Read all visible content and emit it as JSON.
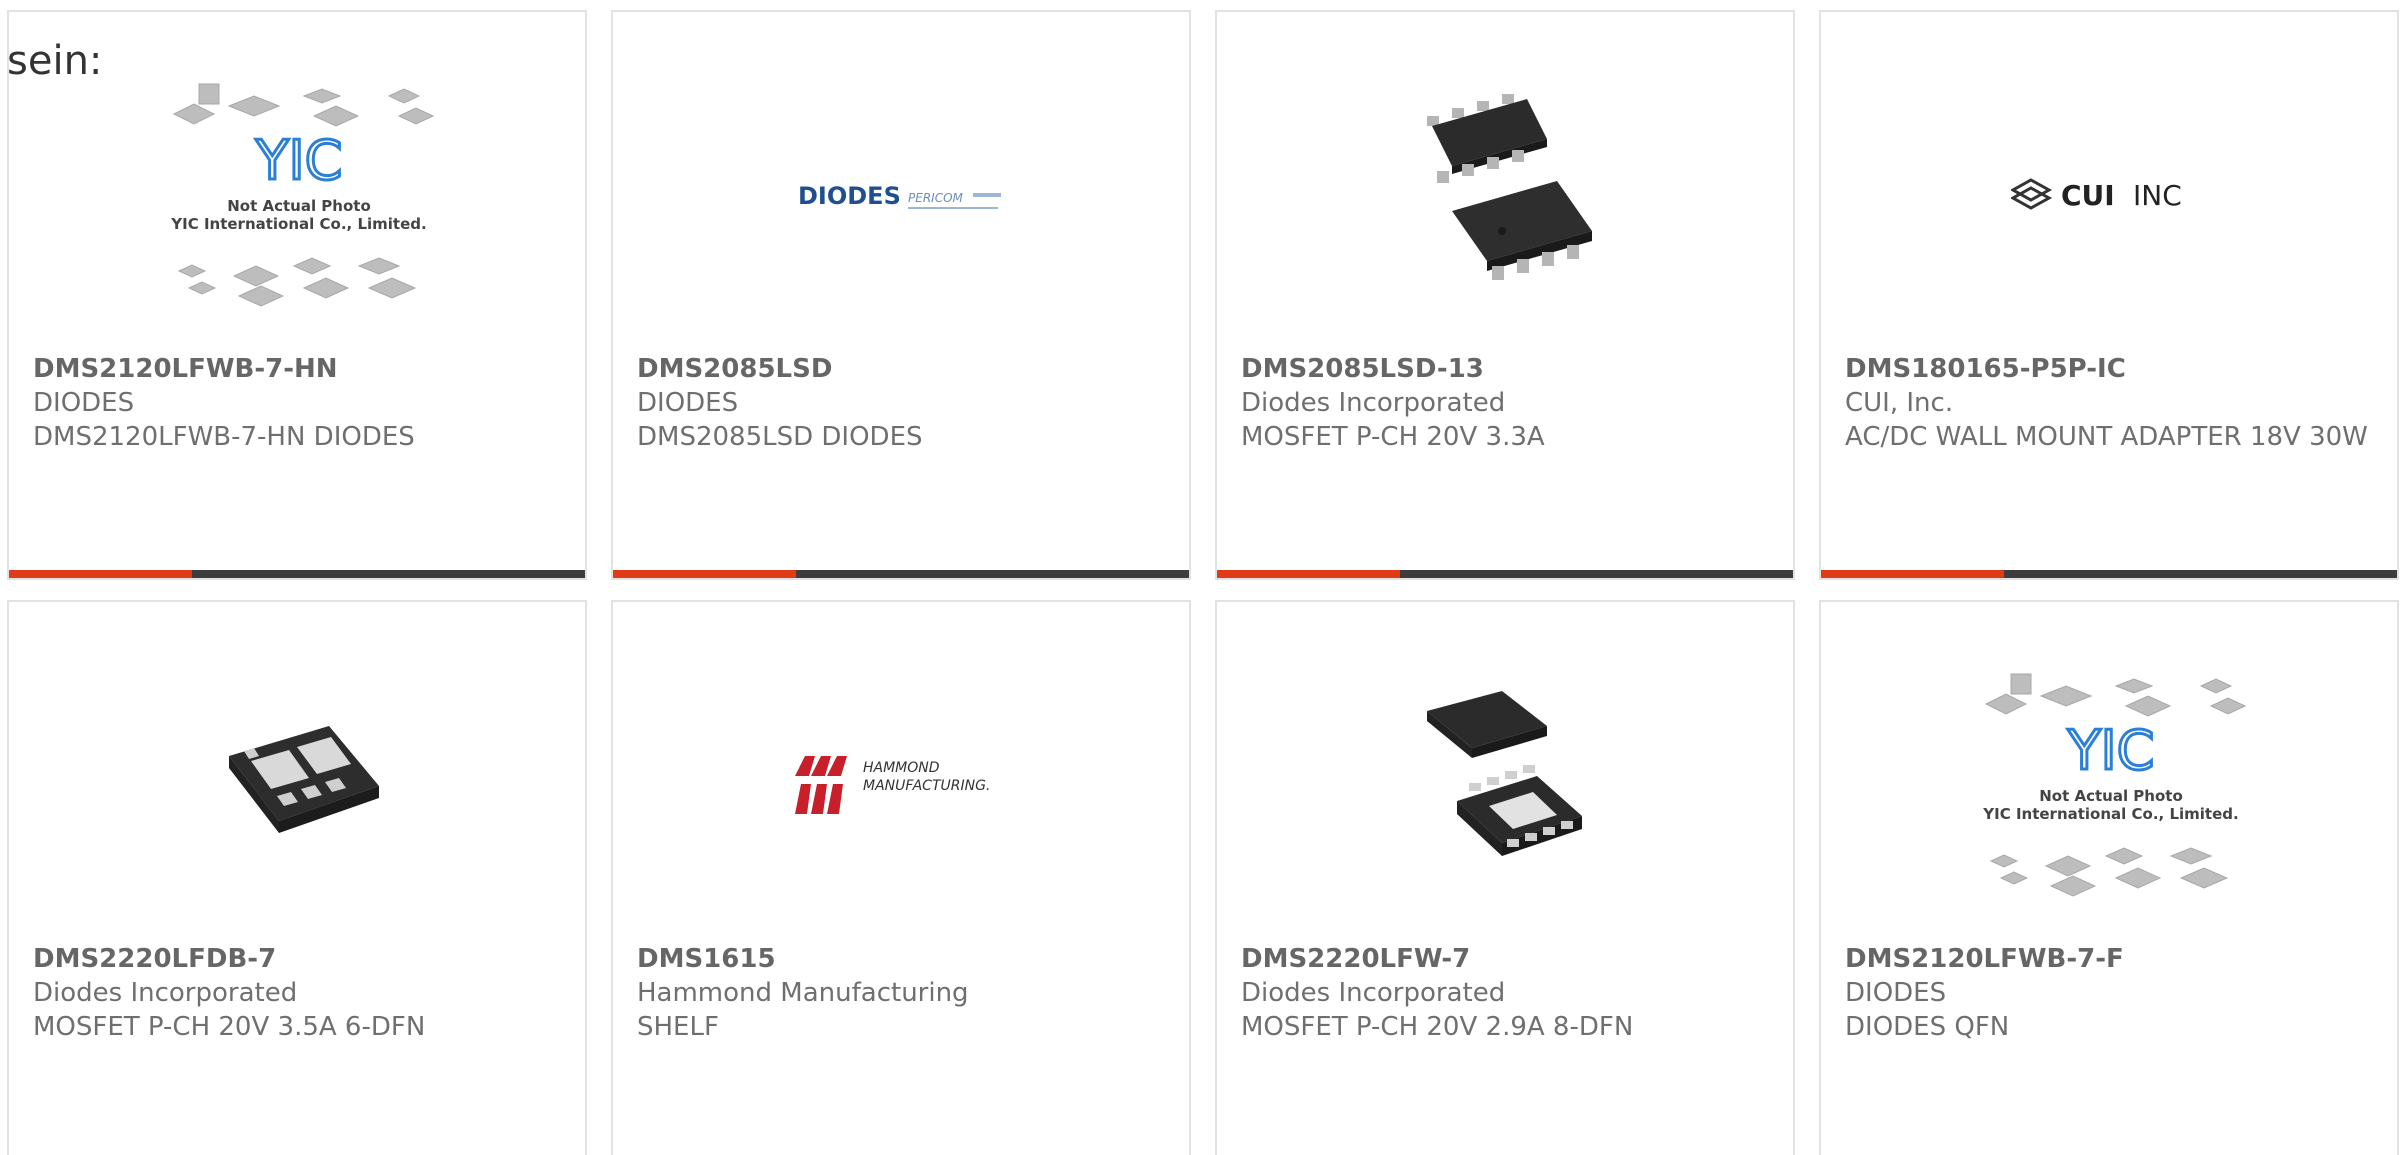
{
  "page": {
    "prefix_text": "sein:"
  },
  "cards": [
    {
      "part": "DMS2120LFWB-7-HN",
      "manufacturer": "DIODES",
      "description": "DMS2120LFWB-7-HN DIODES",
      "image": "placeholder",
      "photo_note_1": "Not Actual Photo",
      "photo_note_2": "YIC International Co., Limited.",
      "logo_text": "YIC"
    },
    {
      "part": "DMS2085LSD",
      "manufacturer": "DIODES",
      "description": "DMS2085LSD DIODES",
      "image": "diodes-logo",
      "logo_text": "DIODES",
      "logo_sub": "PERICOM"
    },
    {
      "part": "DMS2085LSD-13",
      "manufacturer": "Diodes Incorporated",
      "description": "MOSFET P-CH 20V 3.3A",
      "image": "soic-8-chips"
    },
    {
      "part": "DMS180165-P5P-IC",
      "manufacturer": "CUI, Inc.",
      "description": "AC/DC WALL MOUNT ADAPTER 18V 30W",
      "image": "cui-logo",
      "logo_text": "CUI",
      "logo_sub": "INC"
    },
    {
      "part": "DMS2220LFDB-7",
      "manufacturer": "Diodes Incorporated",
      "description": "MOSFET P-CH 20V 3.5A 6-DFN",
      "image": "dfn-6-chip"
    },
    {
      "part": "DMS1615",
      "manufacturer": "Hammond Manufacturing",
      "description": "SHELF",
      "image": "hammond-logo",
      "logo_text": "HAMMOND",
      "logo_sub": "MANUFACTURING."
    },
    {
      "part": "DMS2220LFW-7",
      "manufacturer": "Diodes Incorporated",
      "description": "MOSFET P-CH 20V 2.9A 8-DFN",
      "image": "dfn-8-chips"
    },
    {
      "part": "DMS2120LFWB-7-F",
      "manufacturer": "DIODES",
      "description": "DIODES QFN",
      "image": "placeholder",
      "photo_note_1": "Not Actual Photo",
      "photo_note_2": "YIC International Co., Limited.",
      "logo_text": "YIC"
    }
  ],
  "colors": {
    "accent": "#e03a17",
    "bar": "#3d3d3d",
    "border": "#e2e2e2",
    "text": "#666666"
  }
}
